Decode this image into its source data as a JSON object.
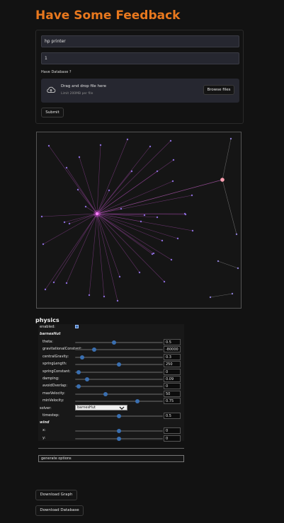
{
  "page": {
    "title": "Have Some Feedback"
  },
  "form": {
    "input1_value": "hp printer",
    "input2_value": "1",
    "db_label": "Have Database ?",
    "drop_title": "Drag and drop file here",
    "drop_limit": "Limit 200MB per file",
    "browse_label": "Browse files",
    "submit_label": "Submit"
  },
  "colors": {
    "accent": "#e8781e",
    "edge": "#c03cc8",
    "node": "#8a6cd8",
    "hub": "#ff9fb0"
  },
  "physics": {
    "header": "physics",
    "enabled_label": "enabled:",
    "barnes_label": "barnesHut",
    "rows": [
      {
        "label": "theta:",
        "value": "0.5",
        "pos": 0.44
      },
      {
        "label": "gravitationalConstant:",
        "value": "-80000",
        "pos": 0.2
      },
      {
        "label": "centralGravity:",
        "value": "0.3",
        "pos": 0.06
      },
      {
        "label": "springLength:",
        "value": "250",
        "pos": 0.5
      },
      {
        "label": "springConstant:",
        "value": "0",
        "pos": 0.02
      },
      {
        "label": "damping:",
        "value": "0.09",
        "pos": 0.12
      },
      {
        "label": "avoidOverlap:",
        "value": "0",
        "pos": 0.02
      },
      {
        "label": "maxVelocity:",
        "value": "50",
        "pos": 0.34
      },
      {
        "label": "minVelocity:",
        "value": "0.75",
        "pos": 0.72
      }
    ],
    "solver_label": "solver:",
    "solver_value": "barnesHut",
    "timestep": {
      "label": "timestep:",
      "value": "0.5",
      "pos": 0.5
    },
    "wind_label": "wind",
    "wind_rows": [
      {
        "label": "x:",
        "value": "0",
        "pos": 0.5
      },
      {
        "label": "y:",
        "value": "0",
        "pos": 0.5
      }
    ],
    "generate_label": "generate options"
  },
  "downloads": {
    "graph_label": "Download Graph",
    "db_label": "Download Database"
  }
}
